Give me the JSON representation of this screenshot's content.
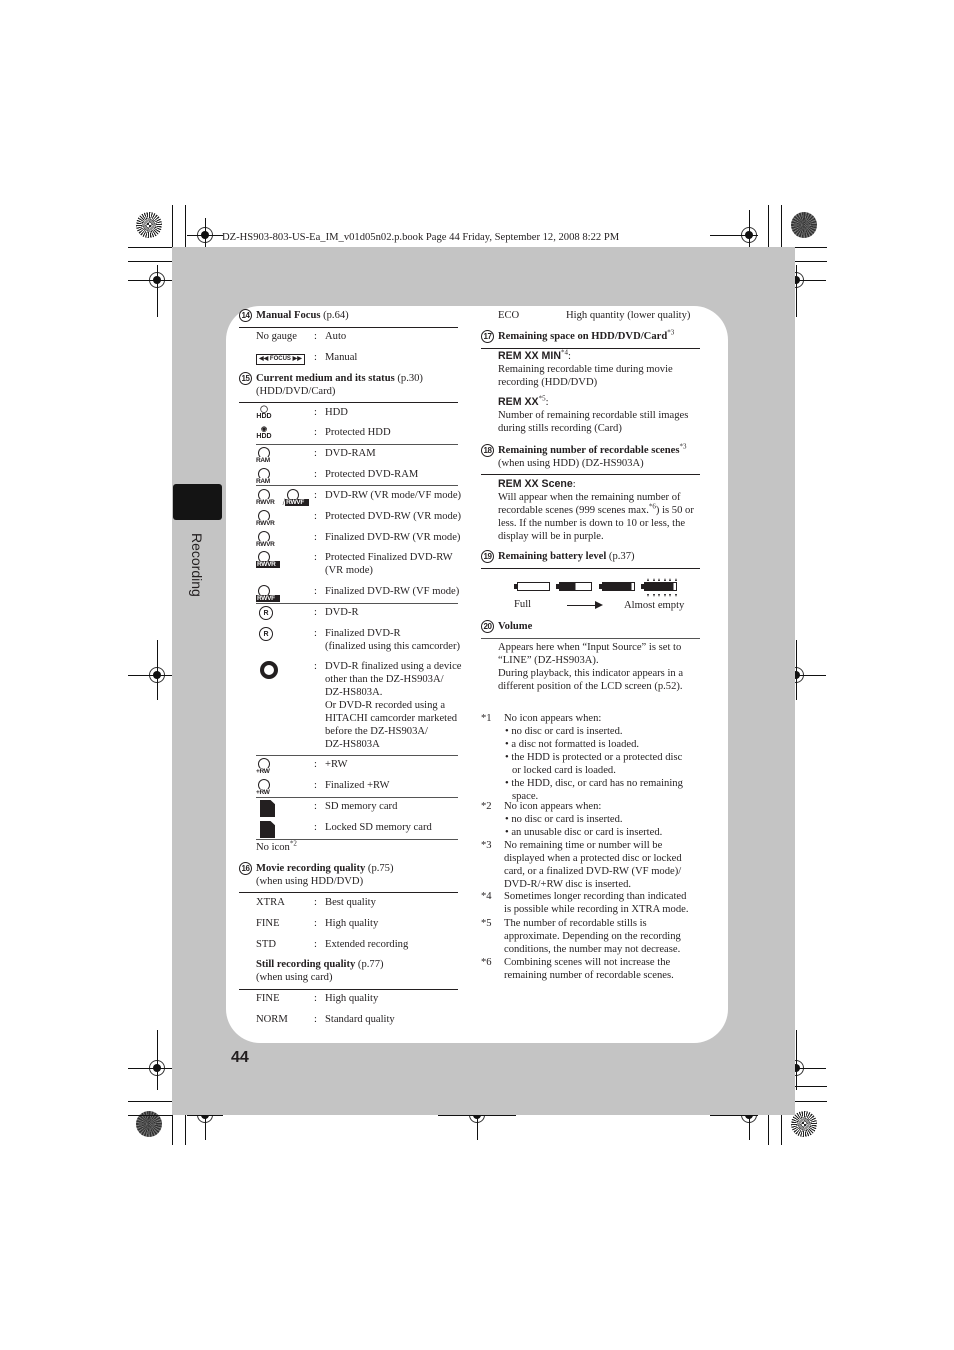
{
  "header": {
    "file_info": "DZ-HS903-803-US-Ea_IM_v01d05n02.p.book  Page 44  Friday, September 12, 2008  8:22 PM"
  },
  "side_tab": {
    "label": "Recording"
  },
  "page_number": "44",
  "left_column": {
    "sec14": {
      "num": "14",
      "title": "Manual Focus",
      "ref": " (p.64)",
      "rows": [
        {
          "key": "No gauge",
          "value": "Auto"
        },
        {
          "key": "FOCUS",
          "value": "Manual",
          "icon": "focus-gauge-icon"
        }
      ]
    },
    "sec15": {
      "num": "15",
      "title": "Current medium and its status",
      "ref": " (p.30)",
      "sub": "(HDD/DVD/Card)",
      "rows": [
        {
          "icon": "hdd-icon",
          "icon_label": "HDD",
          "value": "HDD"
        },
        {
          "icon": "protected-hdd-icon",
          "icon_label": "HDD",
          "value": "Protected HDD"
        },
        {
          "icon": "dvd-ram-icon",
          "icon_label": "RAM",
          "value": "DVD-RAM"
        },
        {
          "icon": "protected-dvd-ram-icon",
          "icon_label": "RAM",
          "value": "Protected DVD-RAM"
        },
        {
          "icon": "dvd-rw-vr-vf-icon",
          "icon_label": "RWVR",
          "icon_label2": "RWVF",
          "value": "DVD-RW (VR mode/VF mode)"
        },
        {
          "icon": "protected-dvd-rw-icon",
          "icon_label": "RWVR",
          "value": "Protected DVD-RW (VR mode)"
        },
        {
          "icon": "finalized-dvd-rw-vr-icon",
          "icon_label": "RWVR",
          "value": "Finalized DVD-RW (VR mode)"
        },
        {
          "icon": "protected-finalized-dvd-rw-icon",
          "icon_label": "RWVR",
          "value": "Protected Finalized DVD-RW",
          "value2": "(VR mode)"
        },
        {
          "icon": "finalized-dvd-rw-vf-icon",
          "icon_label": "RWVF",
          "value": "Finalized DVD-RW (VF mode)"
        },
        {
          "icon": "dvd-r-icon",
          "icon_label": "R",
          "value": "DVD-R"
        },
        {
          "icon": "finalized-dvd-r-icon",
          "icon_label": "R",
          "value": "Finalized DVD-R",
          "value2": "(finalized using this camcorder)"
        },
        {
          "icon": "disc-icon",
          "value_lines": [
            "DVD-R finalized using a device",
            "other than the DZ-HS903A/",
            "DZ-HS803A.",
            "Or DVD-R recorded using a",
            "HITACHI camcorder marketed",
            "before the DZ-HS903A/",
            "DZ-HS803A"
          ]
        },
        {
          "icon": "plus-rw-icon",
          "icon_label": "+RW",
          "value": "+RW"
        },
        {
          "icon": "finalized-plus-rw-icon",
          "icon_label": "+RW",
          "value": "Finalized +RW"
        },
        {
          "icon": "sd-card-icon",
          "value": "SD memory card"
        },
        {
          "icon": "locked-sd-card-icon",
          "value": "Locked SD memory card"
        }
      ],
      "no_icon": "No icon",
      "no_icon_note": "*2"
    },
    "sec16": {
      "num": "16",
      "title": "Movie recording quality",
      "ref": " (p.75)",
      "sub": "(when using HDD/DVD)",
      "rows": [
        {
          "key": "XTRA",
          "value": "Best quality"
        },
        {
          "key": "FINE",
          "value": "High quality"
        },
        {
          "key": "STD",
          "value": "Extended recording"
        }
      ],
      "still_title": "Still recording quality",
      "still_ref": " (p.77)",
      "still_sub": "(when using card)",
      "still_rows": [
        {
          "key": "FINE",
          "value": "High quality"
        },
        {
          "key": "NORM",
          "value": "Standard quality"
        }
      ]
    }
  },
  "right_column": {
    "eco_row": {
      "key": "ECO",
      "value": "High quantity (lower quality)"
    },
    "sec17": {
      "num": "17",
      "title": "Remaining space on HDD/DVD/Card",
      "note": "*3",
      "items": [
        {
          "label": "REM XX MIN",
          "note": "*4",
          "colon": ":",
          "desc": [
            "Remaining recordable time during movie",
            "recording (HDD/DVD)"
          ]
        },
        {
          "label": "REM XX",
          "note": "*5",
          "colon": ":",
          "desc": [
            "Number of remaining recordable still images",
            "during stills recording (Card)"
          ]
        }
      ]
    },
    "sec18": {
      "num": "18",
      "title": "Remaining number of recordable scenes",
      "note": "*3",
      "sub": "(when using HDD) (DZ-HS903A)",
      "label": "REM XX Scene",
      "colon": ":",
      "desc_1": "Will appear when the remaining number of",
      "desc_2a": "recordable scenes (999 scenes max.",
      "desc_2note": "*6",
      "desc_2b": ") is 50 or",
      "desc_3": "less. If the number is down to 10 or less, the",
      "desc_4": "display will be in purple."
    },
    "sec19": {
      "num": "19",
      "title": "Remaining battery level",
      "ref": " (p.37)",
      "battery_levels": [
        1.0,
        0.6,
        0.15,
        0.05
      ],
      "full_label": "Full",
      "empty_label": "Almost empty"
    },
    "sec20": {
      "num": "20",
      "title": "Volume",
      "desc": [
        " Appears here when “Input Source” is set to",
        "“LINE” (DZ-HS903A).",
        "During playback, this indicator appears in a",
        "different position of the LCD screen (p.52)."
      ]
    },
    "footnotes": [
      {
        "n": "*1",
        "lines": [
          "No icon appears when:"
        ],
        "bullets": [
          [
            "no disc or card is inserted."
          ],
          [
            "a disc not formatted is loaded."
          ],
          [
            "the HDD is protected or a protected disc",
            "or locked card is loaded."
          ],
          [
            "the HDD, disc, or card has no remaining",
            "space."
          ]
        ]
      },
      {
        "n": "*2",
        "lines": [
          "No icon appears when:"
        ],
        "bullets": [
          [
            "no disc or card is inserted."
          ],
          [
            "an unusable disc or card is inserted."
          ]
        ]
      },
      {
        "n": "*3",
        "lines": [
          "No remaining time or number will be",
          "displayed when a protected disc or locked",
          "card, or a finalized DVD-RW (VF mode)/",
          "DVD-R/+RW disc is inserted."
        ]
      },
      {
        "n": "*4",
        "lines": [
          "Sometimes longer recording than indicated",
          "is possible while recording in XTRA mode."
        ]
      },
      {
        "n": "*5",
        "lines": [
          "The number of recordable stills is",
          "approximate. Depending on the recording",
          "conditions, the number may not decrease."
        ]
      },
      {
        "n": "*6",
        "lines": [
          "Combining scenes will not increase the",
          "remaining number of recordable scenes."
        ]
      }
    ]
  }
}
